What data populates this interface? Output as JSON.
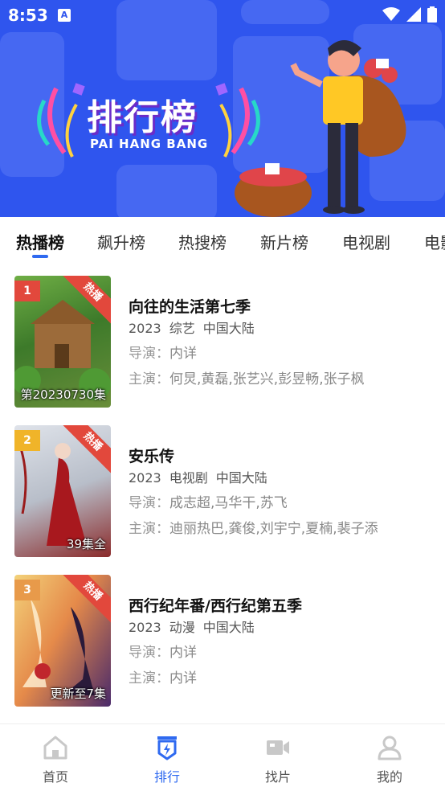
{
  "status_bar": {
    "time": "8:53",
    "notif_icon": "A"
  },
  "banner": {
    "title_cn": "排行榜",
    "title_en": "PAI HANG BANG"
  },
  "tabs": [
    {
      "label": "热播榜",
      "active": true
    },
    {
      "label": "飙升榜",
      "active": false
    },
    {
      "label": "热搜榜",
      "active": false
    },
    {
      "label": "新片榜",
      "active": false
    },
    {
      "label": "电视剧",
      "active": false
    },
    {
      "label": "电影",
      "active": false
    }
  ],
  "items": [
    {
      "rank": "1",
      "badge": "热播",
      "episode": "第20230730集",
      "title": "向往的生活第七季",
      "year": "2023",
      "genre": "综艺",
      "region": "中国大陆",
      "director_label": "导演：",
      "director": "内详",
      "cast_label": "主演：",
      "cast": "何炅,黄磊,张艺兴,彭昱畅,张子枫",
      "rank_color": "#e2483c"
    },
    {
      "rank": "2",
      "badge": "热播",
      "episode": "39集全",
      "title": "安乐传",
      "year": "2023",
      "genre": "电视剧",
      "region": "中国大陆",
      "director_label": "导演：",
      "director": "成志超,马华干,苏飞",
      "cast_label": "主演：",
      "cast": "迪丽热巴,龚俊,刘宇宁,夏楠,裴子添",
      "rank_color": "#f0b429"
    },
    {
      "rank": "3",
      "badge": "热播",
      "episode": "更新至7集",
      "title": "西行纪年番/西行纪第五季",
      "year": "2023",
      "genre": "动漫",
      "region": "中国大陆",
      "director_label": "导演：",
      "director": "内详",
      "cast_label": "主演：",
      "cast": "内详",
      "rank_color": "#e89a4a"
    }
  ],
  "bottom_nav": [
    {
      "label": "首页",
      "icon": "home-icon",
      "active": false
    },
    {
      "label": "排行",
      "icon": "ranking-icon",
      "active": true
    },
    {
      "label": "找片",
      "icon": "video-camera-icon",
      "active": false
    },
    {
      "label": "我的",
      "icon": "user-icon",
      "active": false
    }
  ],
  "colors": {
    "accent": "#2f6af0",
    "banner_bg": "#2f55ee",
    "badge": "#e2483c"
  }
}
